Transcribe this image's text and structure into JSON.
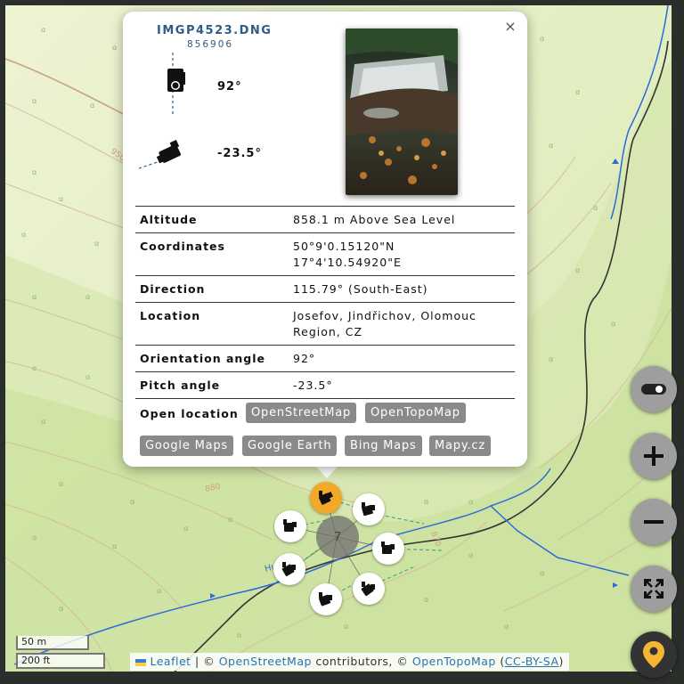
{
  "popup": {
    "filename": "IMGP4523.DNG",
    "file_id": "856906",
    "close_label": "×",
    "orientation_value": "92°",
    "pitch_value": "-23.5°",
    "info": {
      "altitude": {
        "label": "Altitude",
        "value": "858.1 m Above Sea Level"
      },
      "coordinates": {
        "label": "Coordinates",
        "lat": "50°9'0.15120\"N",
        "lon": "17°4'10.54920\"E"
      },
      "direction": {
        "label": "Direction",
        "value": "115.79° (South-East)"
      },
      "location": {
        "label": "Location",
        "line1": "Josefov, Jindřichov, Olomouc",
        "line2": "Region, CZ"
      },
      "orientation": {
        "label": "Orientation angle",
        "value": "92°"
      },
      "pitch": {
        "label": "Pitch angle",
        "value": "-23.5°"
      }
    },
    "open_location": {
      "label": "Open location",
      "links": [
        "OpenStreetMap",
        "OpenTopoMap",
        "Google Maps",
        "Google Earth",
        "Bing Maps",
        "Mapy.cz"
      ]
    }
  },
  "map": {
    "contour_labels": [
      "950",
      "880",
      "870"
    ],
    "stream_label": "Hu  a",
    "cluster_count": "7",
    "scale": {
      "metric": "50 m",
      "imperial": "200 ft"
    },
    "attribution": {
      "leaflet": "Leaflet",
      "sep1": " | © ",
      "osm": "OpenStreetMap",
      "contributors": " contributors, © ",
      "otm": "OpenTopoMap",
      "license_open": " (",
      "license": "CC-BY-SA",
      "license_close": ")"
    }
  },
  "controls": {
    "icons": [
      "toggle-icon",
      "plus-icon",
      "minus-icon",
      "fullscreen-icon",
      "location-pin-icon"
    ]
  },
  "colors": {
    "accent_blue": "#2f5b87",
    "button_gray": "#8a8a8a",
    "selected_marker": "#f2a92a",
    "map_green": "#e2edc4"
  }
}
